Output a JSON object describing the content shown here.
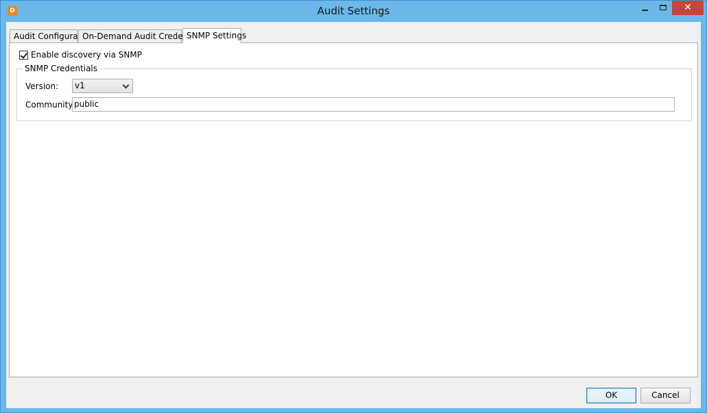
{
  "window": {
    "title": "Audit Settings",
    "app_icon_glyph": "D",
    "close_glyph": "✕"
  },
  "tabs": [
    {
      "label": "Audit Configuration",
      "selected": false
    },
    {
      "label": "On-Demand Audit Credentials",
      "selected": false
    },
    {
      "label": "SNMP Settings",
      "selected": true
    }
  ],
  "snmp": {
    "enable_label": "Enable discovery via SNMP",
    "enable_checked": true,
    "group_title": "SNMP Credentials",
    "version_label": "Version:",
    "version_value": "v1",
    "community_label": "Community:",
    "community_value": "public"
  },
  "buttons": {
    "ok": "OK",
    "cancel": "Cancel"
  },
  "colors": {
    "titlebar": "#6bb7e8",
    "close_button": "#c7463b",
    "app_icon": "#e8871e",
    "client_background": "#f0f0f0"
  }
}
